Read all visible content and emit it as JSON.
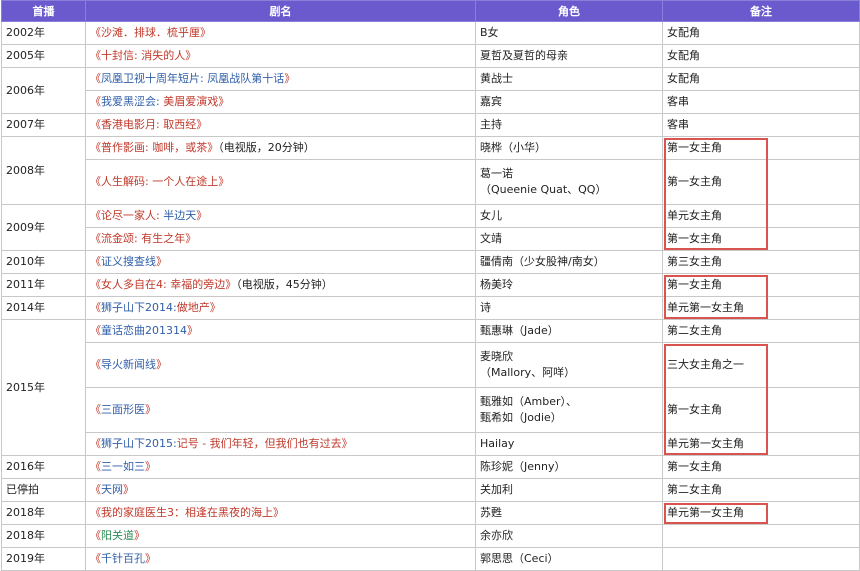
{
  "headers": [
    "首播",
    "剧名",
    "角色",
    "备注"
  ],
  "rows": [
    {
      "title_parts": [
        {
          "t": "沙滩．排球．梳乎厘",
          "c": "red"
        }
      ],
      "suffix": "",
      "role": [
        "B女"
      ],
      "note": "女配角"
    },
    {
      "title_parts": [
        {
          "t": "十封信: 消失的人",
          "c": "red"
        }
      ],
      "suffix": "",
      "role": [
        "夏哲及夏哲的母亲"
      ],
      "note": "女配角"
    },
    {
      "title_parts": [
        {
          "t": "凤凰卫视十周年短片: 凤凰战队第十话",
          "c": "blue"
        }
      ],
      "suffix": "",
      "role": [
        "黄战士"
      ],
      "note": "女配角"
    },
    {
      "title_parts": [
        {
          "t": "我爱黑涩会: ",
          "c": "blue"
        },
        {
          "t": "美眉爱演戏",
          "c": "red"
        }
      ],
      "suffix": "",
      "role": [
        "嘉宾"
      ],
      "note": "客串"
    },
    {
      "title_parts": [
        {
          "t": "香港电影月: 取西经",
          "c": "red"
        }
      ],
      "suffix": "",
      "role": [
        "主持"
      ],
      "note": "客串"
    },
    {
      "title_parts": [
        {
          "t": "普作影画: 咖啡，或茶",
          "c": "red"
        }
      ],
      "suffix": "（电视版，20分钟）",
      "role": [
        "晓桦（小华）"
      ],
      "note": "第一女主角"
    },
    {
      "title_parts": [
        {
          "t": "人生解码: 一个人在途上",
          "c": "red"
        }
      ],
      "suffix": "",
      "role": [
        "葛一诺",
        "（Queenie Quat、QQ）"
      ],
      "note": "第一女主角",
      "tall": true
    },
    {
      "title_parts": [
        {
          "t": "论尽一家人: ",
          "c": "red"
        },
        {
          "t": "半边天",
          "c": "blue"
        }
      ],
      "suffix": "",
      "role": [
        "女儿"
      ],
      "note": "单元女主角"
    },
    {
      "title_parts": [
        {
          "t": "流金颂: 有生之年",
          "c": "red"
        }
      ],
      "suffix": "",
      "role": [
        "文靖"
      ],
      "note": "第一女主角"
    },
    {
      "title_parts": [
        {
          "t": "证义搜查线",
          "c": "blue"
        }
      ],
      "suffix": "",
      "role": [
        "疆倩南（少女股神/南女）"
      ],
      "note": "第三女主角"
    },
    {
      "title_parts": [
        {
          "t": "女人多自在4: 幸福的旁边",
          "c": "red"
        }
      ],
      "suffix": "（电视版，45分钟）",
      "role": [
        "杨美玲"
      ],
      "note": "第一女主角"
    },
    {
      "title_parts": [
        {
          "t": "狮子山下2014:",
          "c": "blue"
        },
        {
          "t": "做地产",
          "c": "red"
        }
      ],
      "suffix": "",
      "role": [
        "诗"
      ],
      "note": "单元第一女主角"
    },
    {
      "title_parts": [
        {
          "t": "童话恋曲201314",
          "c": "blue"
        }
      ],
      "suffix": "",
      "role": [
        "甄惠琳（Jade）"
      ],
      "note": "第二女主角"
    },
    {
      "title_parts": [
        {
          "t": "导火新闻线",
          "c": "blue"
        }
      ],
      "suffix": "",
      "role": [
        "麦晓欣",
        "（Mallory、阿咩）"
      ],
      "note": "三大女主角之一",
      "tall": true
    },
    {
      "title_parts": [
        {
          "t": "三面形医",
          "c": "blue"
        }
      ],
      "suffix": "",
      "role": [
        "甄雅如（Amber）、",
        "甄希如（Jodie）"
      ],
      "note": "第一女主角",
      "tall": true
    },
    {
      "title_parts": [
        {
          "t": "狮子山下2015:",
          "c": "blue"
        },
        {
          "t": "记号 - 我们年轻，但我们也有过去",
          "c": "red"
        }
      ],
      "suffix": "",
      "role": [
        "Hailay"
      ],
      "note": "单元第一女主角"
    },
    {
      "title_parts": [
        {
          "t": "三一如三",
          "c": "blue"
        }
      ],
      "suffix": "",
      "role": [
        "陈珍妮（Jenny）"
      ],
      "note": "第一女主角"
    },
    {
      "title_parts": [
        {
          "t": "天网",
          "c": "blue"
        }
      ],
      "suffix": "",
      "role": [
        "关加利"
      ],
      "note": "第二女主角"
    },
    {
      "title_parts": [
        {
          "t": "我的家庭医生3：相逢在黑夜的海上",
          "c": "red"
        }
      ],
      "suffix": "",
      "role": [
        "苏甦"
      ],
      "note": "单元第一女主角"
    },
    {
      "title_parts": [
        {
          "t": "阳关道",
          "c": "green"
        }
      ],
      "suffix": "",
      "role": [
        "余亦欣"
      ],
      "note": ""
    },
    {
      "title_parts": [
        {
          "t": "千针百孔",
          "c": "blue"
        }
      ],
      "suffix": "",
      "role": [
        "郭思思（Ceci）"
      ],
      "note": ""
    }
  ],
  "years": [
    {
      "label": "2002年",
      "span": 1
    },
    {
      "label": "2005年",
      "span": 1
    },
    {
      "label": "2006年",
      "span": 2
    },
    {
      "label": "2007年",
      "span": 1
    },
    {
      "label": "2008年",
      "span": 2
    },
    {
      "label": "2009年",
      "span": 2
    },
    {
      "label": "2010年",
      "span": 1
    },
    {
      "label": "2011年",
      "span": 1
    },
    {
      "label": "2014年",
      "span": 1
    },
    {
      "label": "2015年",
      "span": 4
    },
    {
      "label": "2016年",
      "span": 1
    },
    {
      "label": "已停拍",
      "span": 1
    },
    {
      "label": "2018年",
      "span": 1
    },
    {
      "label": "2018年",
      "span": 1
    },
    {
      "label": "2019年",
      "span": 1
    }
  ],
  "colors": {
    "header_bg": "#6a5acd",
    "title_red": "#c0392b",
    "title_blue": "#2f5fa8",
    "title_green": "#2e8b57",
    "highlight": "#d9534f"
  },
  "highlights": [
    {
      "from": 5,
      "to": 8
    },
    {
      "from": 10,
      "to": 11
    },
    {
      "from": 13,
      "to": 15
    },
    {
      "from": 18,
      "to": 18
    }
  ]
}
